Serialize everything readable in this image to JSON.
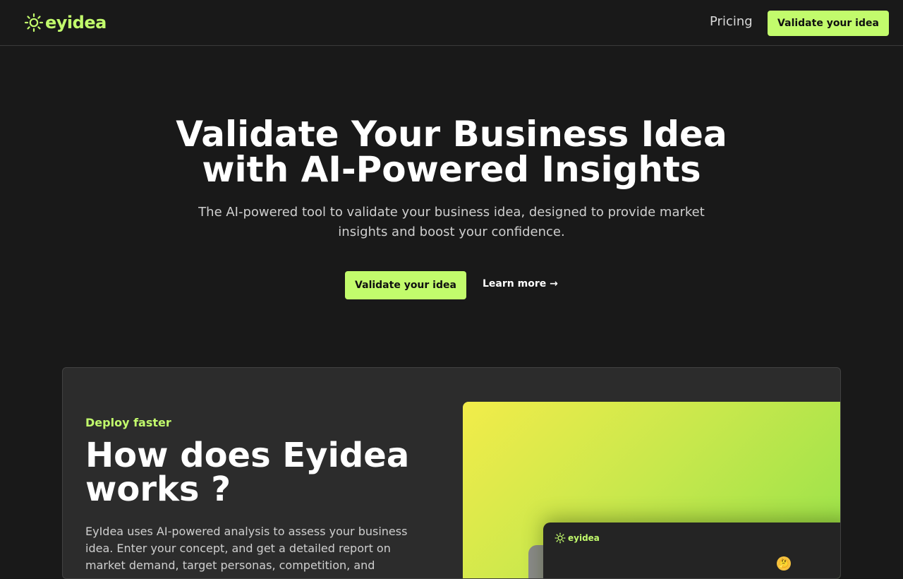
{
  "header": {
    "logo_text": "eyidea",
    "logo_icon": "sun-icon",
    "pricing_label": "Pricing",
    "cta_label": "Validate your idea"
  },
  "hero": {
    "title_line1": "Validate Your Business Idea",
    "title_line2": "with AI-Powered Insights",
    "subtitle": "The AI-powered tool to validate your business idea, designed to provide market insights and boost your confidence.",
    "cta_label": "Validate your idea",
    "learn_more_label": "Learn more →"
  },
  "feature": {
    "eyebrow": "Deploy faster",
    "title": "How does Eyidea works ?",
    "description": "EyIdea uses AI-powered analysis to assess your business idea. Enter your concept, and get a detailed report on market demand, target personas, competition, and",
    "mockup": {
      "logo_text": "eyidea",
      "emoji": "🤔"
    }
  },
  "colors": {
    "accent": "#c2fb6c",
    "background": "#191919",
    "card": "#2c2c2c"
  }
}
